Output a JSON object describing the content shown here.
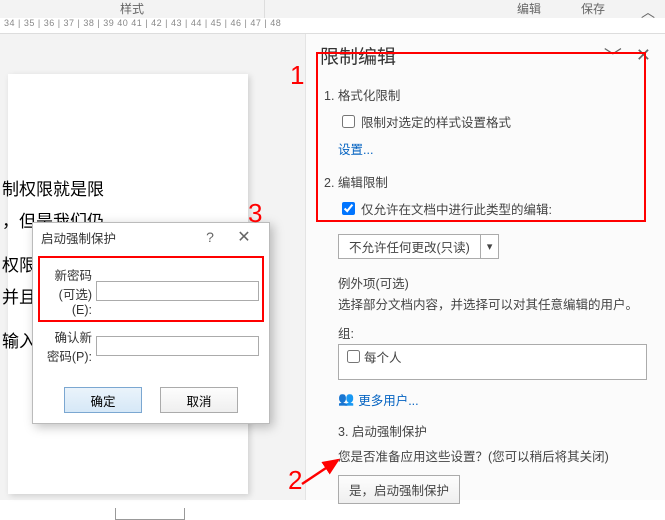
{
  "ribbon": {
    "styles_group": "样式",
    "edit_group": "编辑",
    "save_group": "保存"
  },
  "ruler": "34 | 35 | 36 | 37 | 38 | 39  40  41 | 42 | 43 | 44 | 45 | 46 | 47 | 48",
  "doc": {
    "line1": "制权限就是限",
    "line2": "，但是我们仍",
    "line3": "权限就是禁止",
    "line4": "并且无法删除",
    "line5": "输入新的内容"
  },
  "pane": {
    "title": "限制编辑",
    "section1_title": "1. 格式化限制",
    "format_checkbox": "限制对选定的样式设置格式",
    "settings_link": "设置...",
    "section2_title": "2. 编辑限制",
    "edit_checkbox": "仅允许在文档中进行此类型的编辑:",
    "dropdown_value": "不允许任何更改(只读)",
    "exceptions_title": "例外项(可选)",
    "exceptions_desc": "选择部分文档内容，并选择可以对其任意编辑的用户。",
    "group_label": "组:",
    "group_everyone": "每个人",
    "more_users": "更多用户...",
    "section3_title": "3. 启动强制保护",
    "enforce_text": "您是否准备应用这些设置？(您可以稍后将其关闭)",
    "enforce_button": "是，启动强制保护"
  },
  "dialog": {
    "title": "启动强制保护",
    "pwd_label": "新密码(可选)(E):",
    "confirm_label": "确认新密码(P):",
    "ok": "确定",
    "cancel": "取消"
  },
  "annotations": {
    "a1": "1",
    "a2": "2",
    "a3": "3"
  }
}
